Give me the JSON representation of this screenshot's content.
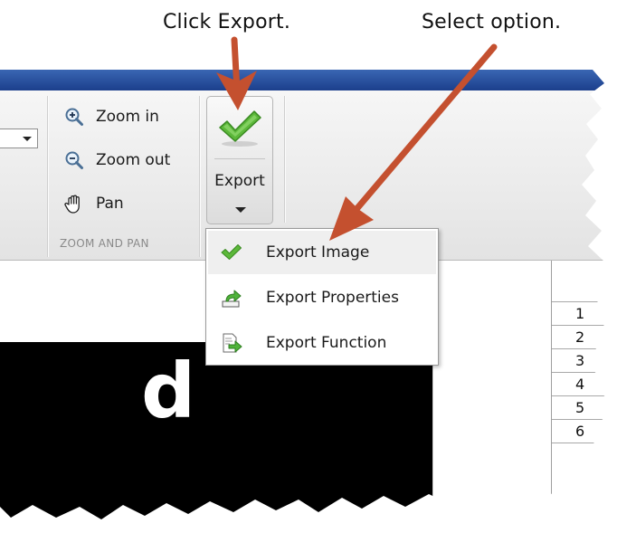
{
  "callouts": {
    "click_export": "Click Export.",
    "select_option": "Select option."
  },
  "toolstrip": {
    "zoom_in": "Zoom in",
    "zoom_out": "Zoom out",
    "pan": "Pan",
    "group_label": "ZOOM AND PAN",
    "export_label": "Export"
  },
  "export_menu": {
    "items": [
      {
        "label": "Export Image",
        "icon": "checkmark-icon"
      },
      {
        "label": "Export Properties",
        "icon": "export-properties-icon"
      },
      {
        "label": "Export Function",
        "icon": "export-function-icon"
      }
    ]
  },
  "table": {
    "rows": [
      "1",
      "2",
      "3",
      "4",
      "5",
      "6"
    ]
  },
  "colors": {
    "annotation_arrow": "#c4502f",
    "titlebar": "#1b3f8c",
    "checkmark": "#5cb83a"
  }
}
